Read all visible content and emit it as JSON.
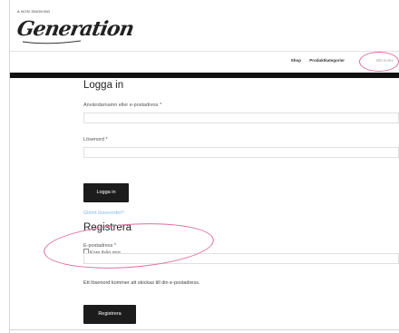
{
  "header": {
    "logo_tagline": "A NON SMOKING",
    "logo_name": "Generation",
    "nav": [
      {
        "label": "Shop"
      },
      {
        "label": "Produktkategorier"
      },
      {
        "label": "Mitt konto"
      }
    ]
  },
  "login": {
    "title": "Logga in",
    "username_label": "Användarnamn eller e-postadress *",
    "username_value": "",
    "password_label": "Lösenord *",
    "password_value": "",
    "remember_label": "Kom ihåg mig",
    "remember_checked": false,
    "submit_label": "Logga in",
    "lost_password_link": "Glömt lösenordet?"
  },
  "register": {
    "title": "Registrera",
    "email_label": "E-postadress *",
    "email_value": "",
    "info_text": "Ett lösenord kommer att skickas till din e-postadress.",
    "submit_label": "Registrera"
  },
  "colors": {
    "annotation_circle": "#dd6fa0",
    "button_bg": "#1c1c1c",
    "link": "#8ab8e8"
  }
}
